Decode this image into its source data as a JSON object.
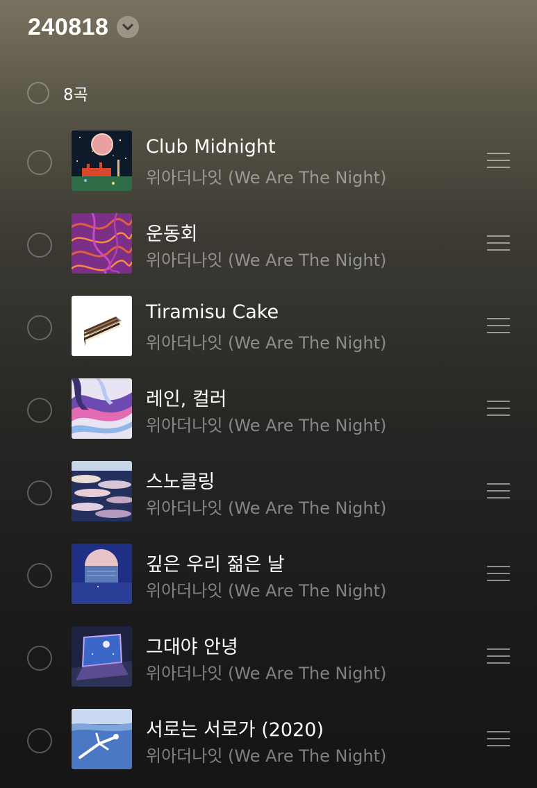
{
  "playlist": {
    "title": "240818",
    "dropdown_icon": "chevron-down-icon"
  },
  "selection": {
    "count_label": "8곡"
  },
  "colors": {
    "background_top": "#7a7260",
    "background_bottom": "#151515",
    "text_primary": "#ffffff",
    "text_secondary": "#8e8e8e"
  },
  "tracks": [
    {
      "title": "Club Midnight",
      "artist": "위아더나잇 (We Are The Night)",
      "art": "night-sky-planet-art"
    },
    {
      "title": "운동회",
      "artist": "위아더나잇 (We Are The Night)",
      "art": "purple-swirl-art"
    },
    {
      "title": "Tiramisu Cake",
      "artist": "위아더나잇 (We Are The Night)",
      "art": "cake-slice-art"
    },
    {
      "title": "레인, 컬러",
      "artist": "위아더나잇 (We Are The Night)",
      "art": "marble-paint-art"
    },
    {
      "title": "스노클링",
      "artist": "위아더나잇 (We Are The Night)",
      "art": "clouds-art"
    },
    {
      "title": "깊은 우리 젊은 날",
      "artist": "위아더나잇 (We Are The Night)",
      "art": "moon-sea-art"
    },
    {
      "title": "그대야 안녕",
      "artist": "위아더나잇 (We Are The Night)",
      "art": "glowing-screen-art"
    },
    {
      "title": "서로는 서로가 (2020)",
      "artist": "위아더나잇 (We Are The Night)",
      "art": "swimmer-art"
    }
  ]
}
